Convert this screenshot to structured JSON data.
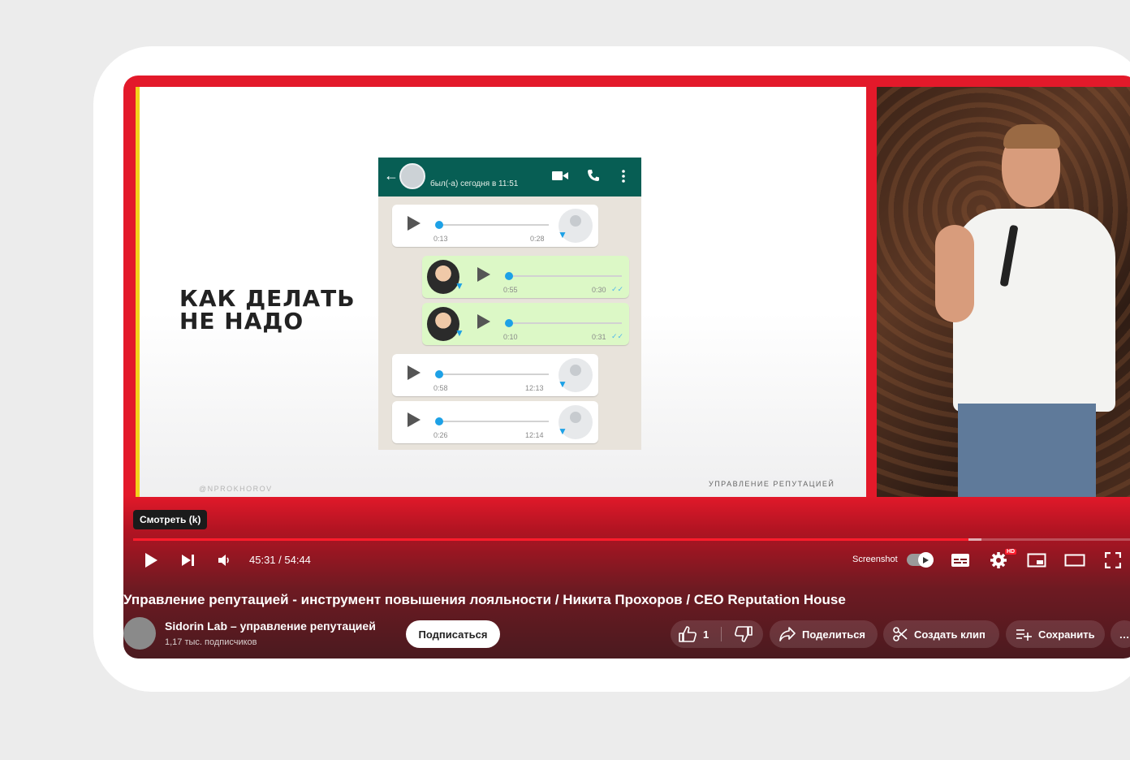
{
  "slide": {
    "heading_line1": "КАК ДЕЛАТЬ",
    "heading_line2": "НЕ НАДО",
    "handle": "@NPROKHOROV",
    "footer": "УПРАВЛЕНИЕ РЕПУТАЦИЕЙ"
  },
  "chat": {
    "status": "был(-а) сегодня в 11:51",
    "messages": [
      {
        "direction": "in",
        "duration": "0:13",
        "time": "0:28"
      },
      {
        "direction": "out",
        "duration": "0:55",
        "time": "0:30"
      },
      {
        "direction": "out",
        "duration": "0:10",
        "time": "0:31"
      },
      {
        "direction": "in",
        "duration": "0:58",
        "time": "12:13"
      },
      {
        "direction": "in",
        "duration": "0:26",
        "time": "12:14"
      }
    ]
  },
  "player": {
    "tooltip": "Смотреть (k)",
    "time_display": "45:31 / 54:44",
    "progress_fraction": 0.831,
    "screenshot_label": "Screenshot",
    "hd_badge": "HD",
    "accent_color": "#ff1c2c",
    "icons": [
      "play-icon",
      "next-icon",
      "volume-icon",
      "subtitles-icon",
      "settings-icon",
      "miniplayer-icon",
      "theater-icon",
      "fullscreen-icon"
    ]
  },
  "video": {
    "title": "Управление репутацией - инструмент повышения лояльности / Никита Прохоров / CEO Reputation House",
    "channel_name": "Sidorin Lab – управление репутацией",
    "subscribers": "1,17 тыс. подписчиков",
    "subscribe_label": "Подписаться",
    "likes": "1",
    "share_label": "Поделиться",
    "clip_label": "Создать клип",
    "save_label": "Сохранить",
    "more_label": "…"
  }
}
